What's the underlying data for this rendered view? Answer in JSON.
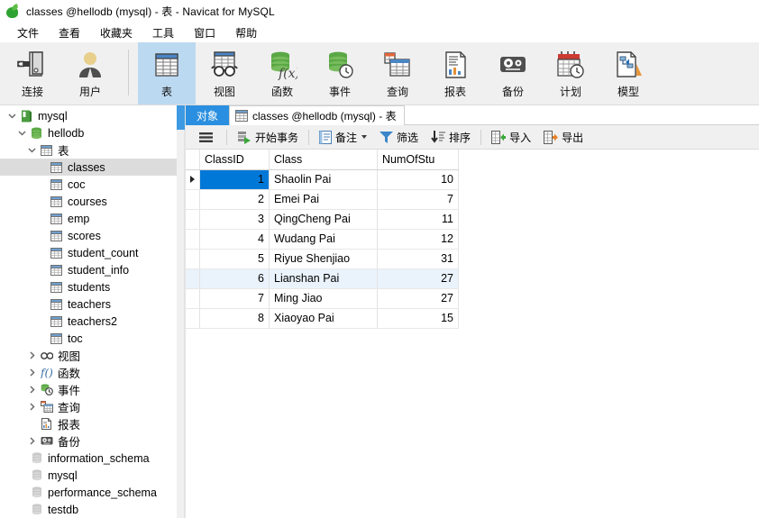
{
  "window": {
    "title": "classes @hellodb (mysql) - 表 - Navicat for MySQL",
    "logo_icon": "navicat-logo-icon"
  },
  "menubar": {
    "items": [
      {
        "label": "文件",
        "name": "menu-file"
      },
      {
        "label": "查看",
        "name": "menu-view"
      },
      {
        "label": "收藏夹",
        "name": "menu-favorites"
      },
      {
        "label": "工具",
        "name": "menu-tools"
      },
      {
        "label": "窗口",
        "name": "menu-window"
      },
      {
        "label": "帮助",
        "name": "menu-help"
      }
    ]
  },
  "toolbar": {
    "items": [
      {
        "label": "连接",
        "icon": "connection-icon",
        "active": false
      },
      {
        "label": "用户",
        "icon": "user-icon",
        "active": false
      },
      {
        "label": "表",
        "icon": "table-icon",
        "active": true
      },
      {
        "label": "视图",
        "icon": "view-icon",
        "active": false
      },
      {
        "label": "函数",
        "icon": "function-icon",
        "active": false
      },
      {
        "label": "事件",
        "icon": "event-icon",
        "active": false
      },
      {
        "label": "查询",
        "icon": "query-icon",
        "active": false
      },
      {
        "label": "报表",
        "icon": "report-icon",
        "active": false
      },
      {
        "label": "备份",
        "icon": "backup-icon",
        "active": false
      },
      {
        "label": "计划",
        "icon": "schedule-icon",
        "active": false
      },
      {
        "label": "模型",
        "icon": "model-icon",
        "active": false
      }
    ]
  },
  "sidebar": {
    "tree": [
      {
        "label": "mysql",
        "icon": "server-icon",
        "indent": 0,
        "chevron": "down",
        "selected": false
      },
      {
        "label": "hellodb",
        "icon": "database-icon",
        "indent": 1,
        "chevron": "down",
        "selected": false
      },
      {
        "label": "表",
        "icon": "tables-folder-icon",
        "indent": 2,
        "chevron": "down",
        "selected": false
      },
      {
        "label": "classes",
        "icon": "table-item-icon",
        "indent": 3,
        "chevron": "none",
        "selected": true
      },
      {
        "label": "coc",
        "icon": "table-item-icon",
        "indent": 3,
        "chevron": "none",
        "selected": false
      },
      {
        "label": "courses",
        "icon": "table-item-icon",
        "indent": 3,
        "chevron": "none",
        "selected": false
      },
      {
        "label": "emp",
        "icon": "table-item-icon",
        "indent": 3,
        "chevron": "none",
        "selected": false
      },
      {
        "label": "scores",
        "icon": "table-item-icon",
        "indent": 3,
        "chevron": "none",
        "selected": false
      },
      {
        "label": "student_count",
        "icon": "table-item-icon",
        "indent": 3,
        "chevron": "none",
        "selected": false
      },
      {
        "label": "student_info",
        "icon": "table-item-icon",
        "indent": 3,
        "chevron": "none",
        "selected": false
      },
      {
        "label": "students",
        "icon": "table-item-icon",
        "indent": 3,
        "chevron": "none",
        "selected": false
      },
      {
        "label": "teachers",
        "icon": "table-item-icon",
        "indent": 3,
        "chevron": "none",
        "selected": false
      },
      {
        "label": "teachers2",
        "icon": "table-item-icon",
        "indent": 3,
        "chevron": "none",
        "selected": false
      },
      {
        "label": "toc",
        "icon": "table-item-icon",
        "indent": 3,
        "chevron": "none",
        "selected": false
      },
      {
        "label": "视图",
        "icon": "views-icon",
        "indent": 2,
        "chevron": "right",
        "selected": false
      },
      {
        "label": "函数",
        "icon": "functions-icon",
        "indent": 2,
        "chevron": "right",
        "selected": false
      },
      {
        "label": "事件",
        "icon": "events-icon",
        "indent": 2,
        "chevron": "right",
        "selected": false
      },
      {
        "label": "查询",
        "icon": "queries-icon",
        "indent": 2,
        "chevron": "right",
        "selected": false
      },
      {
        "label": "报表",
        "icon": "reports-icon",
        "indent": 2,
        "chevron": "none",
        "selected": false
      },
      {
        "label": "备份",
        "icon": "backups-icon",
        "indent": 2,
        "chevron": "right",
        "selected": false
      },
      {
        "label": "information_schema",
        "icon": "database-closed-icon",
        "indent": 1,
        "chevron": "none",
        "selected": false
      },
      {
        "label": "mysql",
        "icon": "database-closed-icon",
        "indent": 1,
        "chevron": "none",
        "selected": false
      },
      {
        "label": "performance_schema",
        "icon": "database-closed-icon",
        "indent": 1,
        "chevron": "none",
        "selected": false
      },
      {
        "label": "testdb",
        "icon": "database-closed-icon",
        "indent": 1,
        "chevron": "none",
        "selected": false
      }
    ]
  },
  "tabs": {
    "object_tab": "对象",
    "document_tab": "classes @hellodb (mysql) - 表"
  },
  "actionbar": {
    "menu_icon": "hamburger-menu-icon",
    "items": [
      {
        "label": "开始事务",
        "icon": "begin-transaction-icon",
        "caret": false
      },
      {
        "label": "备注",
        "icon": "note-icon",
        "caret": true
      },
      {
        "label": "筛选",
        "icon": "filter-icon",
        "caret": false
      },
      {
        "label": "排序",
        "icon": "sort-icon",
        "caret": false
      },
      {
        "label": "导入",
        "icon": "import-icon",
        "caret": false
      },
      {
        "label": "导出",
        "icon": "export-icon",
        "caret": false
      }
    ]
  },
  "grid": {
    "columns": [
      "ClassID",
      "Class",
      "NumOfStu"
    ],
    "rows": [
      {
        "ClassID": "1",
        "Class": "Shaolin Pai",
        "NumOfStu": "10",
        "current": true,
        "hover": false
      },
      {
        "ClassID": "2",
        "Class": "Emei Pai",
        "NumOfStu": "7",
        "current": false,
        "hover": false
      },
      {
        "ClassID": "3",
        "Class": "QingCheng Pai",
        "NumOfStu": "11",
        "current": false,
        "hover": false
      },
      {
        "ClassID": "4",
        "Class": "Wudang Pai",
        "NumOfStu": "12",
        "current": false,
        "hover": false
      },
      {
        "ClassID": "5",
        "Class": "Riyue Shenjiao",
        "NumOfStu": "31",
        "current": false,
        "hover": false
      },
      {
        "ClassID": "6",
        "Class": "Lianshan Pai",
        "NumOfStu": "27",
        "current": false,
        "hover": true
      },
      {
        "ClassID": "7",
        "Class": "Ming Jiao",
        "NumOfStu": "27",
        "current": false,
        "hover": false
      },
      {
        "ClassID": "8",
        "Class": "Xiaoyao Pai",
        "NumOfStu": "15",
        "current": false,
        "hover": false
      }
    ]
  },
  "colors": {
    "selection_blue": "#0078D7",
    "tab_blue": "#2A8FE0",
    "toolbar_active": "#BCD9F2",
    "toolbar_bg": "#F0F0F0",
    "tree_selected": "#DCDCDC"
  }
}
